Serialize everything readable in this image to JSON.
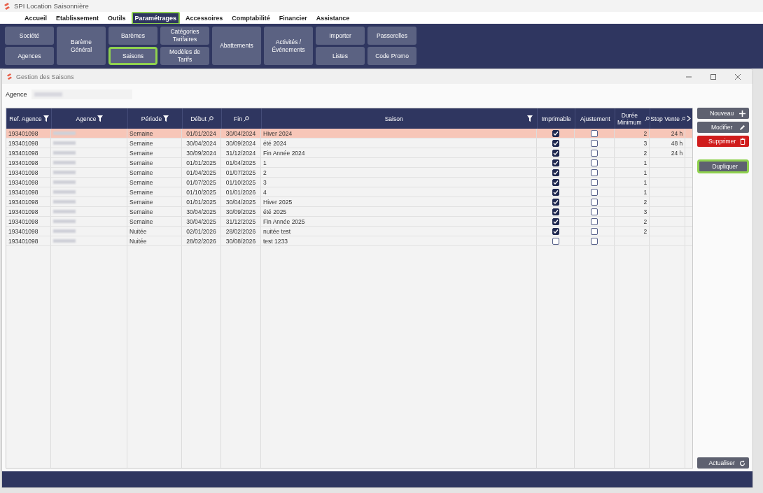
{
  "app_title": "SPI Location Saisonnière",
  "menu": [
    {
      "label": "Accueil",
      "selected": false,
      "highlighted": false
    },
    {
      "label": "Etablissement",
      "selected": false,
      "highlighted": false
    },
    {
      "label": "Outils",
      "selected": false,
      "highlighted": false
    },
    {
      "label": "Paramétrages",
      "selected": true,
      "highlighted": true
    },
    {
      "label": "Accessoires",
      "selected": false,
      "highlighted": false
    },
    {
      "label": "Comptabilité",
      "selected": false,
      "highlighted": false
    },
    {
      "label": "Financier",
      "selected": false,
      "highlighted": false
    },
    {
      "label": "Assistance",
      "selected": false,
      "highlighted": false
    }
  ],
  "ribbon": [
    {
      "buttons": [
        {
          "label": "Société",
          "highlighted": false
        },
        {
          "label": "Agences",
          "highlighted": false
        }
      ]
    },
    {
      "buttons": [
        {
          "label": "Barème Général",
          "highlighted": false
        }
      ]
    },
    {
      "buttons": [
        {
          "label": "Barèmes",
          "highlighted": false
        },
        {
          "label": "Saisons",
          "highlighted": true
        }
      ]
    },
    {
      "buttons": [
        {
          "label": "Catégories Tarifaires",
          "highlighted": false
        },
        {
          "label": "Modèles de Tarifs",
          "highlighted": false
        }
      ]
    },
    {
      "buttons": [
        {
          "label": "Abattements",
          "highlighted": false
        }
      ]
    },
    {
      "buttons": [
        {
          "label": "Activités / Événements",
          "highlighted": false
        }
      ]
    },
    {
      "buttons": [
        {
          "label": "Importer",
          "highlighted": false
        },
        {
          "label": "Listes",
          "highlighted": false
        }
      ]
    },
    {
      "buttons": [
        {
          "label": "Passerelles",
          "highlighted": false
        },
        {
          "label": "Code Promo",
          "highlighted": false
        }
      ]
    }
  ],
  "window": {
    "title": "Gestion des Saisons",
    "agence_label": "Agence"
  },
  "table": {
    "columns": [
      {
        "label": "Ref. Agence",
        "kind": "filter"
      },
      {
        "label": "Agence",
        "kind": "filter"
      },
      {
        "label": "Période",
        "kind": "filter"
      },
      {
        "label": "Début",
        "kind": "search"
      },
      {
        "label": "Fin",
        "kind": "search"
      },
      {
        "label": "Saison",
        "kind": "filter"
      },
      {
        "label": "Imprimable",
        "kind": "plain"
      },
      {
        "label": "Ajustement",
        "kind": "plain"
      },
      {
        "label": "Durée Minimum",
        "kind": "search"
      },
      {
        "label": "Stop Vente",
        "kind": "search"
      }
    ],
    "rows": [
      {
        "ref": "193401098",
        "periode": "Semaine",
        "debut": "01/01/2024",
        "fin": "30/04/2024",
        "saison": "Hiver 2024",
        "imprimable": true,
        "ajustement": false,
        "duree": "2",
        "stop": "24 h",
        "selected": true
      },
      {
        "ref": "193401098",
        "periode": "Semaine",
        "debut": "30/04/2024",
        "fin": "30/09/2024",
        "saison": "été 2024",
        "imprimable": true,
        "ajustement": false,
        "duree": "3",
        "stop": "48 h",
        "selected": false
      },
      {
        "ref": "193401098",
        "periode": "Semaine",
        "debut": "30/09/2024",
        "fin": "31/12/2024",
        "saison": "Fin Année 2024",
        "imprimable": true,
        "ajustement": false,
        "duree": "2",
        "stop": "24 h",
        "selected": false
      },
      {
        "ref": "193401098",
        "periode": "Semaine",
        "debut": "01/01/2025",
        "fin": "01/04/2025",
        "saison": "1",
        "imprimable": true,
        "ajustement": false,
        "duree": "1",
        "selected": false
      },
      {
        "ref": "193401098",
        "periode": "Semaine",
        "debut": "01/04/2025",
        "fin": "01/07/2025",
        "saison": "2",
        "imprimable": true,
        "ajustement": false,
        "duree": "1",
        "selected": false
      },
      {
        "ref": "193401098",
        "periode": "Semaine",
        "debut": "01/07/2025",
        "fin": "01/10/2025",
        "saison": "3",
        "imprimable": true,
        "ajustement": false,
        "duree": "1",
        "selected": false
      },
      {
        "ref": "193401098",
        "periode": "Semaine",
        "debut": "01/10/2025",
        "fin": "01/01/2026",
        "saison": "4",
        "imprimable": true,
        "ajustement": false,
        "duree": "1",
        "selected": false
      },
      {
        "ref": "193401098",
        "periode": "Semaine",
        "debut": "01/01/2025",
        "fin": "30/04/2025",
        "saison": "Hiver 2025",
        "imprimable": true,
        "ajustement": false,
        "duree": "2",
        "selected": false
      },
      {
        "ref": "193401098",
        "periode": "Semaine",
        "debut": "30/04/2025",
        "fin": "30/09/2025",
        "saison": "été 2025",
        "imprimable": true,
        "ajustement": false,
        "duree": "3",
        "selected": false
      },
      {
        "ref": "193401098",
        "periode": "Semaine",
        "debut": "30/04/2025",
        "fin": "31/12/2025",
        "saison": "Fin Année 2025",
        "imprimable": true,
        "ajustement": false,
        "duree": "2",
        "selected": false
      },
      {
        "ref": "193401098",
        "periode": "Nuitée",
        "debut": "02/01/2026",
        "fin": "28/02/2026",
        "saison": "nuitée test",
        "imprimable": true,
        "ajustement": false,
        "duree": "2",
        "selected": false
      },
      {
        "ref": "193401098",
        "periode": "Nuitée",
        "debut": "28/02/2026",
        "fin": "30/08/2026",
        "saison": "test 1233",
        "imprimable": false,
        "ajustement": false,
        "selected": false
      }
    ]
  },
  "actions": [
    {
      "label": "Nouveau",
      "kind": "add",
      "highlighted": false
    },
    {
      "label": "Modifier",
      "kind": "edit",
      "highlighted": false
    },
    {
      "label": "Supprimer",
      "kind": "delete",
      "highlighted": false
    },
    {
      "label": "Dupliquer",
      "kind": "duplicate",
      "highlighted": true
    }
  ],
  "refresh_button": {
    "label": "Actualiser"
  }
}
